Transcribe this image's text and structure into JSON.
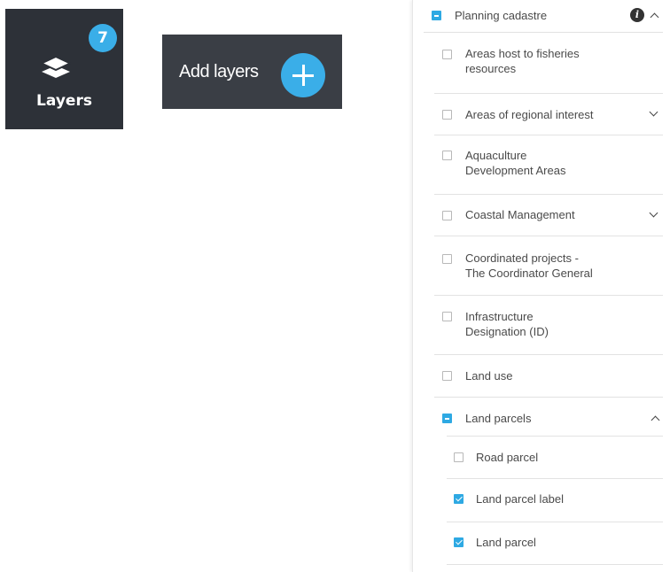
{
  "layers_button": {
    "label": "Layers",
    "badge_count": "7",
    "icon": "layers-stack-icon"
  },
  "add_layers_button": {
    "label": "Add layers",
    "icon": "plus-circle-icon"
  },
  "panel": {
    "header": {
      "label": "Planning cadastre",
      "state": "partial",
      "info_icon": "info-icon",
      "expanded": true
    },
    "items": [
      {
        "label_lines": [
          "Areas host to fisheries",
          "resources"
        ],
        "checked": false
      },
      {
        "label_lines": [
          "Areas of regional interest"
        ],
        "checked": false,
        "expandable": true
      },
      {
        "label_lines": [
          "Aquaculture",
          "Development Areas"
        ],
        "checked": false
      },
      {
        "label_lines": [
          "Coastal Management"
        ],
        "checked": false,
        "expandable": true
      },
      {
        "label_lines": [
          "Coordinated projects -",
          "The Coordinator General"
        ],
        "checked": false
      },
      {
        "label_lines": [
          "Infrastructure",
          "Designation (ID)"
        ],
        "checked": false
      },
      {
        "label_lines": [
          "Land use"
        ],
        "checked": false
      },
      {
        "label_lines": [
          "Land parcels"
        ],
        "state": "partial",
        "expanded": true,
        "children": [
          {
            "label": "Road parcel",
            "checked": false
          },
          {
            "label": "Land parcel label",
            "checked": true
          },
          {
            "label": "Land parcel",
            "checked": true
          }
        ]
      }
    ]
  },
  "colors": {
    "accent": "#2ea9e3",
    "button_bg": "#2d3138",
    "badge": "#3aaee8"
  }
}
